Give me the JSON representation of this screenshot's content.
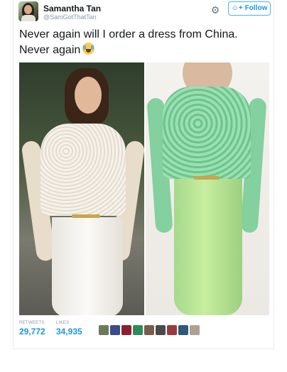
{
  "author": {
    "display_name": "Samantha Tan",
    "handle": "@SamGotThatTan"
  },
  "header": {
    "follow_label": "Follow",
    "follow_icon": "user-plus-icon",
    "settings_icon": "gear-icon"
  },
  "tweet": {
    "text_line1": "Never again will I order a dress from China.",
    "text_line2": "Never again",
    "emoji": "face-with-tears-of-joy"
  },
  "media": {
    "photos": [
      "photo-advertised-dress",
      "photo-received-dress"
    ]
  },
  "stats": {
    "retweets_label": "RETWEETS",
    "retweets_count": "29,772",
    "likes_label": "LIKES",
    "likes_count": "34,935"
  },
  "colors": {
    "link_blue": "#1b95e0",
    "follow_border": "#4ab3f4",
    "meta_gray": "#8899a6",
    "text_dark": "#14171a"
  },
  "likers": [
    {
      "color": "#6a7b5c"
    },
    {
      "color": "#3b4a8a"
    },
    {
      "color": "#8a2030"
    },
    {
      "color": "#2e8b57"
    },
    {
      "color": "#7a5c4a"
    },
    {
      "color": "#4a4a4a"
    },
    {
      "color": "#9a3c3c"
    },
    {
      "color": "#2c5a7a"
    },
    {
      "color": "#b0a090"
    }
  ]
}
